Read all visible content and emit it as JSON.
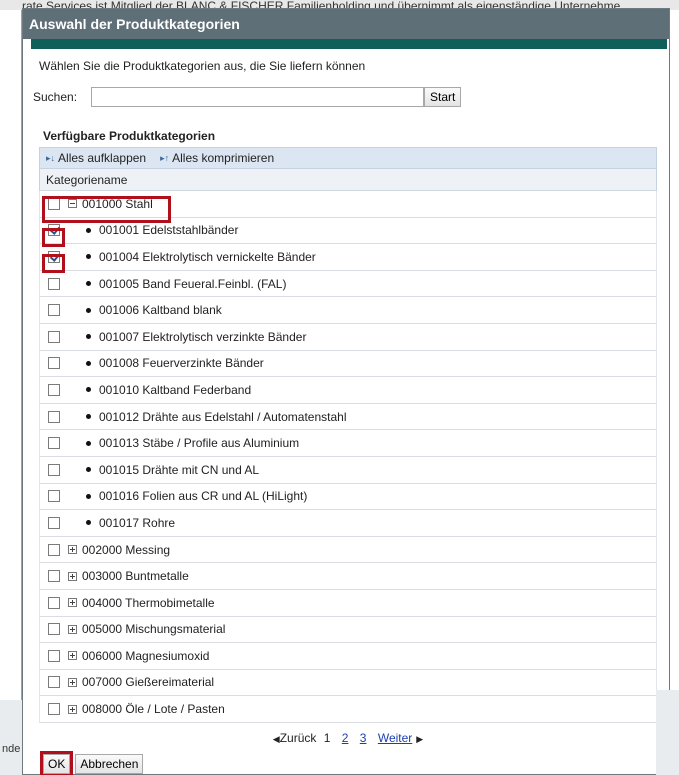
{
  "background": {
    "top_text": "rate Services ist Mitglied der BLANC & FISCHER Familienholding und übernimmt als eigenständige Unternehme",
    "left_text": "nde"
  },
  "dialog": {
    "title": "Auswahl der Produktkategorien",
    "intro": "Wählen Sie die Produktkategorien aus, die Sie liefern können",
    "search": {
      "label": "Suchen:",
      "value": "",
      "button": "Start"
    },
    "section_title": "Verfügbare Produktkategorien",
    "toolbar": {
      "expand_all": "Alles aufklappen",
      "collapse_all": "Alles komprimieren"
    },
    "column_header": "Kategoriename",
    "rows": [
      {
        "label": "001000 Stahl",
        "level": 0,
        "expanded": true,
        "checked": false
      },
      {
        "label": "001001 Edelststahlbänder",
        "level": 1,
        "checked": true
      },
      {
        "label": "001004 Elektrolytisch vernickelte Bänder",
        "level": 1,
        "checked": true
      },
      {
        "label": "001005 Band Feueral.Feinbl. (FAL)",
        "level": 1,
        "checked": false
      },
      {
        "label": "001006 Kaltband blank",
        "level": 1,
        "checked": false
      },
      {
        "label": "001007 Elektrolytisch verzinkte Bänder",
        "level": 1,
        "checked": false
      },
      {
        "label": "001008 Feuerverzinkte Bänder",
        "level": 1,
        "checked": false
      },
      {
        "label": "001010 Kaltband Federband",
        "level": 1,
        "checked": false
      },
      {
        "label": "001012 Drähte aus Edelstahl / Automatenstahl",
        "level": 1,
        "checked": false
      },
      {
        "label": "001013 Stäbe / Profile aus Aluminium",
        "level": 1,
        "checked": false
      },
      {
        "label": "001015 Drähte mit CN und AL",
        "level": 1,
        "checked": false
      },
      {
        "label": "001016 Folien aus CR und AL (HiLight)",
        "level": 1,
        "checked": false
      },
      {
        "label": "001017 Rohre",
        "level": 1,
        "checked": false
      },
      {
        "label": "002000 Messing",
        "level": 0,
        "expanded": false,
        "checked": false
      },
      {
        "label": "003000 Buntmetalle",
        "level": 0,
        "expanded": false,
        "checked": false
      },
      {
        "label": "004000 Thermobimetalle",
        "level": 0,
        "expanded": false,
        "checked": false
      },
      {
        "label": "005000 Mischungsmaterial",
        "level": 0,
        "expanded": false,
        "checked": false
      },
      {
        "label": "006000 Magnesiumoxid",
        "level": 0,
        "expanded": false,
        "checked": false
      },
      {
        "label": "007000 Gießereimaterial",
        "level": 0,
        "expanded": false,
        "checked": false
      },
      {
        "label": "008000 Öle / Lote / Pasten",
        "level": 0,
        "expanded": false,
        "checked": false
      }
    ],
    "pager": {
      "prev": "Zurück",
      "current": "1",
      "pages": [
        "2",
        "3"
      ],
      "next": "Weiter"
    },
    "buttons": {
      "ok": "OK",
      "cancel": "Abbrechen"
    },
    "highlight_color": "#b0101c"
  }
}
